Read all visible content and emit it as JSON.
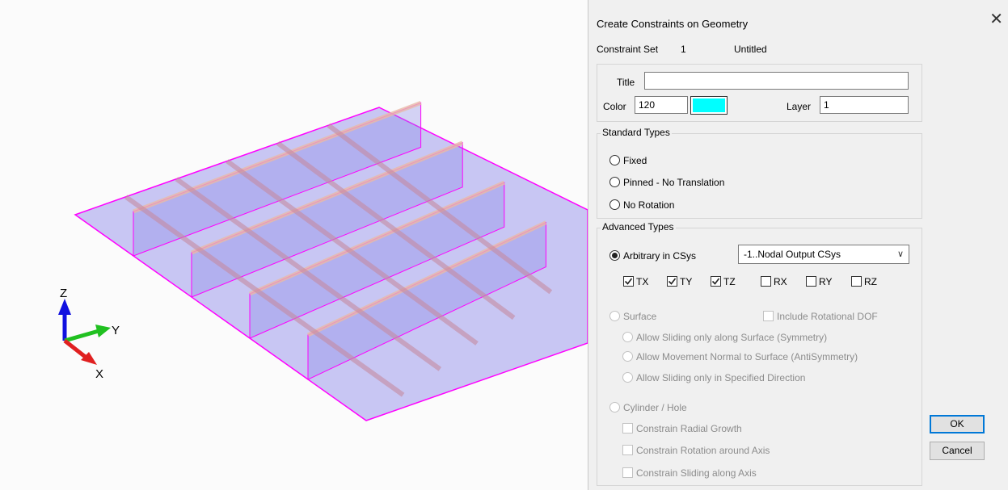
{
  "viewport": {
    "axes": {
      "x": "X",
      "y": "Y",
      "z": "Z"
    },
    "colors": {
      "plate": "#8a86e8",
      "edge": "#ff00ff",
      "beam": "#e8b9a8"
    }
  },
  "dialog": {
    "title": "Create Constraints on Geometry",
    "close_glyph": "✕",
    "constraint_set_label": "Constraint Set",
    "constraint_set_id": "1",
    "constraint_set_name": "Untitled",
    "title_label": "Title",
    "title_value": "",
    "color_label": "Color",
    "color_value": "120",
    "color_swatch": "#00ffff",
    "layer_label": "Layer",
    "layer_value": "1",
    "standard_types": {
      "label": "Standard Types",
      "options": [
        "Fixed",
        "Pinned - No Translation",
        "No Rotation"
      ]
    },
    "advanced_types": {
      "label": "Advanced Types",
      "arbitrary_label": "Arbitrary in CSys",
      "csys_selected": "-1..Nodal Output CSys",
      "dofs": [
        {
          "label": "TX",
          "checked": true
        },
        {
          "label": "TY",
          "checked": true
        },
        {
          "label": "TZ",
          "checked": true
        },
        {
          "label": "RX",
          "checked": false
        },
        {
          "label": "RY",
          "checked": false
        },
        {
          "label": "RZ",
          "checked": false
        }
      ],
      "surface_label": "Surface",
      "include_rot_dof_label": "Include Rotational DOF",
      "surface_options": [
        "Allow Sliding only along Surface (Symmetry)",
        "Allow Movement Normal to Surface (AntiSymmetry)",
        "Allow Sliding only in Specified Direction"
      ],
      "cylinder_label": "Cylinder / Hole",
      "cylinder_options": [
        "Constrain Radial Growth",
        "Constrain Rotation around Axis",
        "Constrain Sliding along Axis"
      ]
    },
    "ok_label": "OK",
    "cancel_label": "Cancel"
  }
}
